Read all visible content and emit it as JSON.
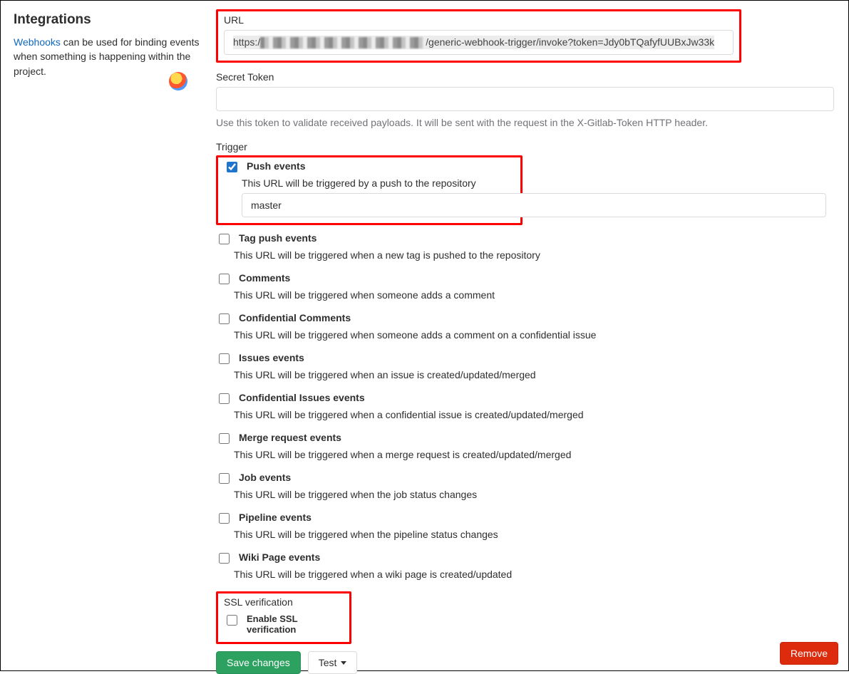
{
  "sidebar": {
    "title": "Integrations",
    "link_text": "Webhooks",
    "desc_rest": " can be used for binding events when something is happening within the project."
  },
  "url": {
    "label": "URL",
    "prefix": "https:/",
    "suffix": "/generic-webhook-trigger/invoke?token=Jdy0bTQafyfUUBxJw33k"
  },
  "secret": {
    "label": "Secret Token",
    "value": "",
    "help": "Use this token to validate received payloads. It will be sent with the request in the X-Gitlab-Token HTTP header."
  },
  "trigger": {
    "label": "Trigger",
    "push": {
      "label": "Push events",
      "checked": true,
      "desc": "This URL will be triggered by a push to the repository",
      "branch_value": "master"
    },
    "items": [
      {
        "key": "tag",
        "label": "Tag push events",
        "desc": "This URL will be triggered when a new tag is pushed to the repository",
        "checked": false
      },
      {
        "key": "comments",
        "label": "Comments",
        "desc": "This URL will be triggered when someone adds a comment",
        "checked": false
      },
      {
        "key": "conf_comments",
        "label": "Confidential Comments",
        "desc": "This URL will be triggered when someone adds a comment on a confidential issue",
        "checked": false
      },
      {
        "key": "issues",
        "label": "Issues events",
        "desc": "This URL will be triggered when an issue is created/updated/merged",
        "checked": false
      },
      {
        "key": "conf_issues",
        "label": "Confidential Issues events",
        "desc": "This URL will be triggered when a confidential issue is created/updated/merged",
        "checked": false
      },
      {
        "key": "merge",
        "label": "Merge request events",
        "desc": "This URL will be triggered when a merge request is created/updated/merged",
        "checked": false
      },
      {
        "key": "job",
        "label": "Job events",
        "desc": "This URL will be triggered when the job status changes",
        "checked": false
      },
      {
        "key": "pipeline",
        "label": "Pipeline events",
        "desc": "This URL will be triggered when the pipeline status changes",
        "checked": false
      },
      {
        "key": "wiki",
        "label": "Wiki Page events",
        "desc": "This URL will be triggered when a wiki page is created/updated",
        "checked": false
      }
    ]
  },
  "ssl": {
    "label": "SSL verification",
    "checkbox_label": "Enable SSL verification",
    "checked": false
  },
  "buttons": {
    "save": "Save changes",
    "test": "Test",
    "remove": "Remove"
  }
}
